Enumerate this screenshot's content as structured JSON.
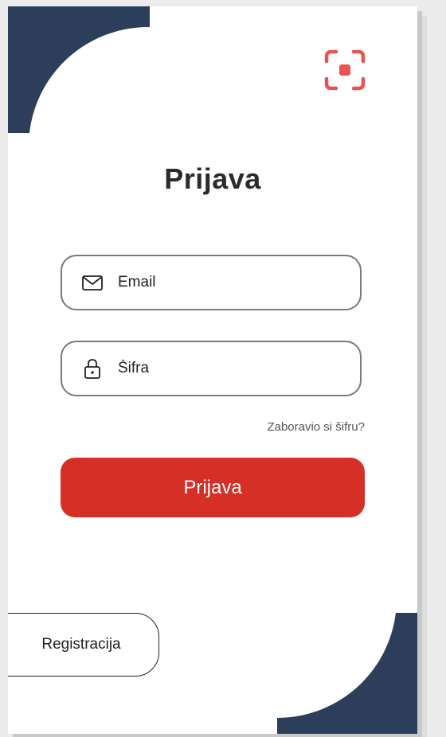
{
  "title": "Prijava",
  "icons": {
    "scan": "qr-scan-icon",
    "email": "envelope-icon",
    "password": "lock-icon"
  },
  "form": {
    "email_placeholder": "Email",
    "password_placeholder": "Šifra",
    "forgot_label": "Zaboravio si šifru?",
    "submit_label": "Prijava"
  },
  "register_label": "Registracija",
  "colors": {
    "accent": "#d52f26",
    "scan_icon": "#e95350",
    "corner": "#2c3e5a"
  }
}
